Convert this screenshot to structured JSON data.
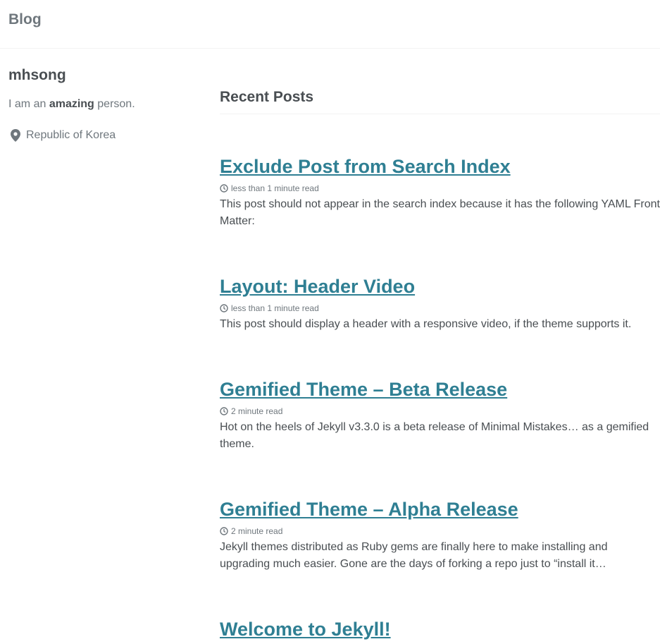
{
  "masthead": {
    "title": "Blog"
  },
  "author": {
    "name": "mhsong",
    "bio_prefix": "I am an ",
    "bio_bold": "amazing",
    "bio_suffix": " person.",
    "location": "Republic of Korea",
    "location_icon": "map-marker-icon"
  },
  "main": {
    "heading": "Recent Posts",
    "posts": [
      {
        "title": "Exclude Post from Search Index",
        "read_time": "less than 1 minute read",
        "excerpt": "This post should not appear in the search index because it has the following YAML Front Matter:"
      },
      {
        "title": "Layout: Header Video",
        "read_time": "less than 1 minute read",
        "excerpt": "This post should display a header with a responsive video, if the theme supports it."
      },
      {
        "title": "Gemified Theme – Beta Release",
        "read_time": "2 minute read",
        "excerpt": "Hot on the heels of Jekyll v3.3.0 is a beta release of Minimal Mistakes… as a gemified theme."
      },
      {
        "title": "Gemified Theme – Alpha Release",
        "read_time": "2 minute read",
        "excerpt": "Jekyll themes distributed as Ruby gems are finally here to make installing and upgrading much easier. Gone are the days of forking a repo just to “install it…"
      },
      {
        "title": "Welcome to Jekyll!",
        "read_time": "",
        "excerpt": ""
      }
    ]
  },
  "colors": {
    "link": "#2f7f93",
    "text": "#494e52",
    "muted": "#6f777d"
  }
}
